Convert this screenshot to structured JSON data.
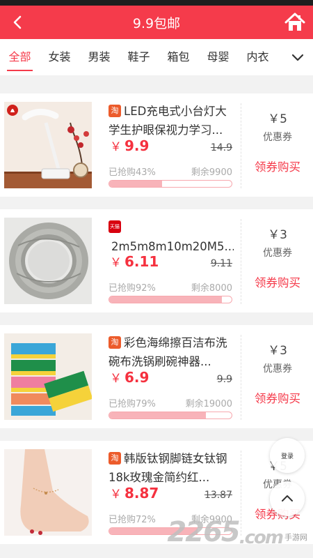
{
  "header": {
    "title": "9.9包邮"
  },
  "tabs": [
    "全部",
    "女装",
    "男装",
    "鞋子",
    "箱包",
    "母婴",
    "内衣"
  ],
  "products": [
    {
      "source": "淘",
      "name": "LED充电式小台灯大学生护眼保视力学习...",
      "price": "9.9",
      "original_price": "14.9",
      "sold": "已抢购43%",
      "sold_fraction": 0.43,
      "remaining": "剩余9900",
      "coupon": "￥5",
      "coupon_label": "优惠券",
      "claim": "领券购买",
      "image": "desk-lamp-photo"
    },
    {
      "source": "天猫",
      "name": "2m5m8m10m20M5...",
      "price": "6.11",
      "original_price": "9.11",
      "sold": "已抢购92%",
      "sold_fraction": 0.92,
      "remaining": "剩余8000",
      "coupon": "￥3",
      "coupon_label": "优惠券",
      "claim": "领券购买",
      "image": "cable-coil-photo"
    },
    {
      "source": "淘",
      "name": "彩色海绵擦百洁布洗碗布洗锅刷碗神器...",
      "price": "6.9",
      "original_price": "9.9",
      "sold": "已抢购79%",
      "sold_fraction": 0.79,
      "remaining": "剩余19000",
      "coupon": "￥3",
      "coupon_label": "优惠券",
      "claim": "领券购买",
      "image": "sponge-photo"
    },
    {
      "source": "淘",
      "name": "韩版钛钢脚链女钛钢18k玫瑰金简约红...",
      "price": "8.87",
      "original_price": "13.87",
      "sold": "已抢购72%",
      "sold_fraction": 0.72,
      "remaining": "剩余9900",
      "coupon": "￥5",
      "coupon_label": "优惠券",
      "claim": "领券购买",
      "image": "anklet-photo"
    }
  ],
  "yen_symbol": "￥",
  "float_login": "登录",
  "watermark": {
    "number": "2265",
    "suffix": ".com",
    "site": "手游网"
  },
  "colors": {
    "accent": "#f53b4b",
    "price": "#f5313f",
    "progress": "#f8b3b9"
  }
}
